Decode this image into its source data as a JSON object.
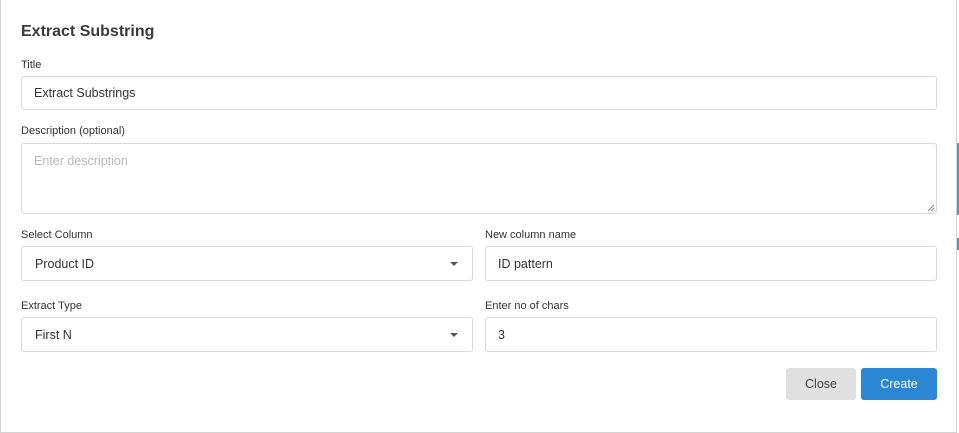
{
  "dialog": {
    "title": "Extract Substring"
  },
  "fields": {
    "title": {
      "label": "Title",
      "value": "Extract Substrings"
    },
    "description": {
      "label": "Description (optional)",
      "placeholder": "Enter description",
      "value": ""
    },
    "select_column": {
      "label": "Select Column",
      "value": "Product ID"
    },
    "new_column_name": {
      "label": "New column name",
      "value": "ID pattern"
    },
    "extract_type": {
      "label": "Extract Type",
      "value": "First N"
    },
    "no_of_chars": {
      "label": "Enter no of chars",
      "value": "3"
    }
  },
  "buttons": {
    "close": "Close",
    "create": "Create"
  },
  "icons": {
    "select_caret": "chevron-down-icon",
    "resize_grip": "resize-grip-icon"
  },
  "colors": {
    "primary": "#2b86d3",
    "secondary_button": "#e0e0e0",
    "border": "#d9d9d9"
  }
}
